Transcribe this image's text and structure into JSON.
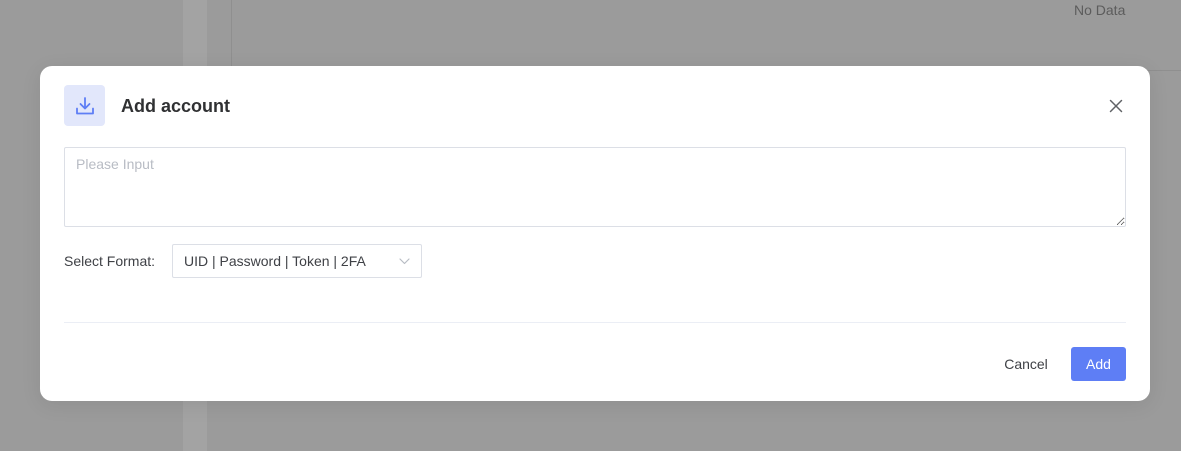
{
  "background": {
    "no_data_text": "No Data"
  },
  "modal": {
    "title": "Add account",
    "icon": "download-icon",
    "close_icon": "close-icon",
    "textarea": {
      "placeholder": "Please Input",
      "value": ""
    },
    "format": {
      "label": "Select Format:",
      "selected": "UID | Password | Token | 2FA",
      "icon": "chevron-down-icon"
    },
    "footer": {
      "cancel_label": "Cancel",
      "add_label": "Add"
    }
  },
  "colors": {
    "accent": "#5e7ef5",
    "icon_bg": "#e2e7fb",
    "overlay": "#9b9b9b"
  }
}
